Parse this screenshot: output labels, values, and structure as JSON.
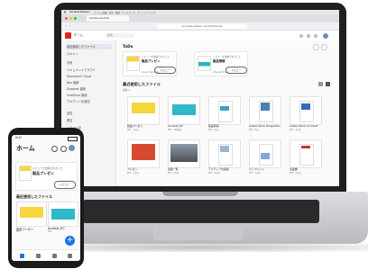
{
  "laptop": {
    "menubar": {
      "app_name": "Acrobat Reader",
      "menus": [
        "ファイル",
        "編集",
        "表示",
        "履歴",
        "ブックマーク",
        "ウィンドウ",
        "ヘルプ"
      ]
    },
    "browser": {
      "tab_label": "Adobe Acrobat",
      "address": "acrobat.adobe.com/link/home"
    },
    "app": {
      "search_placeholder": "検索"
    },
    "sidebar": {
      "items": [
        {
          "label": "最近使用したファイル"
        },
        {
          "label": "スキャン"
        },
        {
          "label": "共有"
        },
        {
          "label": "ドキュメントクラウド"
        },
        {
          "label": "Document Cloud"
        },
        {
          "label": "Box 接続"
        },
        {
          "label": "Dropbox 接続"
        },
        {
          "label": "OneDrive 接続"
        },
        {
          "label": "アカウントを追加"
        },
        {
          "label": "送信"
        },
        {
          "label": "署名"
        },
        {
          "label": "レビュー中"
        },
        {
          "label": "共有済み"
        }
      ]
    },
    "main": {
      "todo_title": "ToDo",
      "todo_cards": [
        {
          "small": "レビューを依頼されました",
          "name": "製品プレゼン",
          "user": "Anne Friedman",
          "button": "レビュー"
        },
        {
          "small": "レビューを依頼されました",
          "name": "製品情報",
          "user": "Charlie Brown",
          "button": "レビュー"
        }
      ],
      "recent_title": "最近使用したファイル",
      "recent_sub": "最新 ▾",
      "files_row1": [
        {
          "name": "製品プレゼン",
          "meta": "PDF · 1分前"
        },
        {
          "name": "Acrobat_DC",
          "meta": "PDF · 2時間前"
        },
        {
          "name": "製品情報",
          "meta": "PDF · 昨日"
        },
        {
          "name": "Adobe Stock Prospectus",
          "meta": "PDF · 昨日"
        },
        {
          "name": "Adobe Stock Contract",
          "meta": "PDF · 2日前"
        }
      ],
      "files_row2": [
        {
          "name": "プレゼン",
          "meta": "PDF · 3日前"
        },
        {
          "name": "出張一覧",
          "meta": "PDF · 4日前"
        },
        {
          "name": "アイディアの提案",
          "meta": "PDF · 4日前"
        },
        {
          "name": "パンフレット",
          "meta": "PDF · 5日前"
        },
        {
          "name": "企画書",
          "meta": "PDF · 6日前"
        }
      ]
    }
  },
  "phone": {
    "status_time": "9:41",
    "title": "ホーム",
    "card": {
      "small": "レビューを依頼されました",
      "name": "製品プレゼン",
      "button": "レビュー"
    },
    "section": "最近使用したファイル",
    "files": [
      {
        "name": "製品プレゼン",
        "meta": "PDF"
      },
      {
        "name": "Acrobat_DC",
        "meta": "PDF"
      }
    ],
    "fab": "+"
  }
}
